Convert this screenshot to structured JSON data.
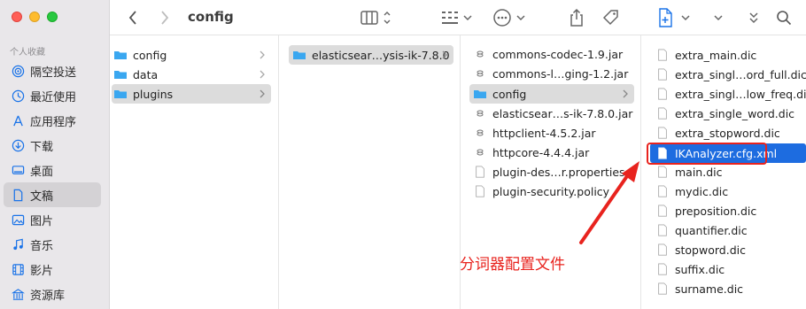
{
  "window": {
    "title": "config"
  },
  "sidebar": {
    "section_label": "个人收藏",
    "items": [
      {
        "label": "隔空投送",
        "icon": "airdrop-icon"
      },
      {
        "label": "最近使用",
        "icon": "clock-icon"
      },
      {
        "label": "应用程序",
        "icon": "applications-icon"
      },
      {
        "label": "下载",
        "icon": "download-icon"
      },
      {
        "label": "桌面",
        "icon": "desktop-icon"
      },
      {
        "label": "文稿",
        "icon": "document-icon"
      },
      {
        "label": "图片",
        "icon": "photo-icon"
      },
      {
        "label": "音乐",
        "icon": "music-icon"
      },
      {
        "label": "影片",
        "icon": "film-icon"
      },
      {
        "label": "资源库",
        "icon": "library-icon"
      }
    ]
  },
  "columns": {
    "col1": [
      "config",
      "data",
      "plugins"
    ],
    "col2": [
      "elasticsear…ysis-ik-7.8.0"
    ],
    "col3": [
      "commons-codec-1.9.jar",
      "commons-l…ging-1.2.jar",
      "config",
      "elasticsear…s-ik-7.8.0.jar",
      "httpclient-4.5.2.jar",
      "httpcore-4.4.4.jar",
      "plugin-des…r.properties",
      "plugin-security.policy"
    ],
    "col4": [
      "extra_main.dic",
      "extra_singl…ord_full.dic",
      "extra_singl…low_freq.dic",
      "extra_single_word.dic",
      "extra_stopword.dic",
      "IKAnalyzer.cfg.xml",
      "main.dic",
      "mydic.dic",
      "preposition.dic",
      "quantifier.dic",
      "stopword.dic",
      "suffix.dic",
      "surname.dic"
    ]
  },
  "annotation": {
    "text": "分词器配置文件",
    "color": "#e8231e"
  },
  "colors": {
    "selection": "#1d6ce0",
    "folder": "#3aa7f0"
  }
}
